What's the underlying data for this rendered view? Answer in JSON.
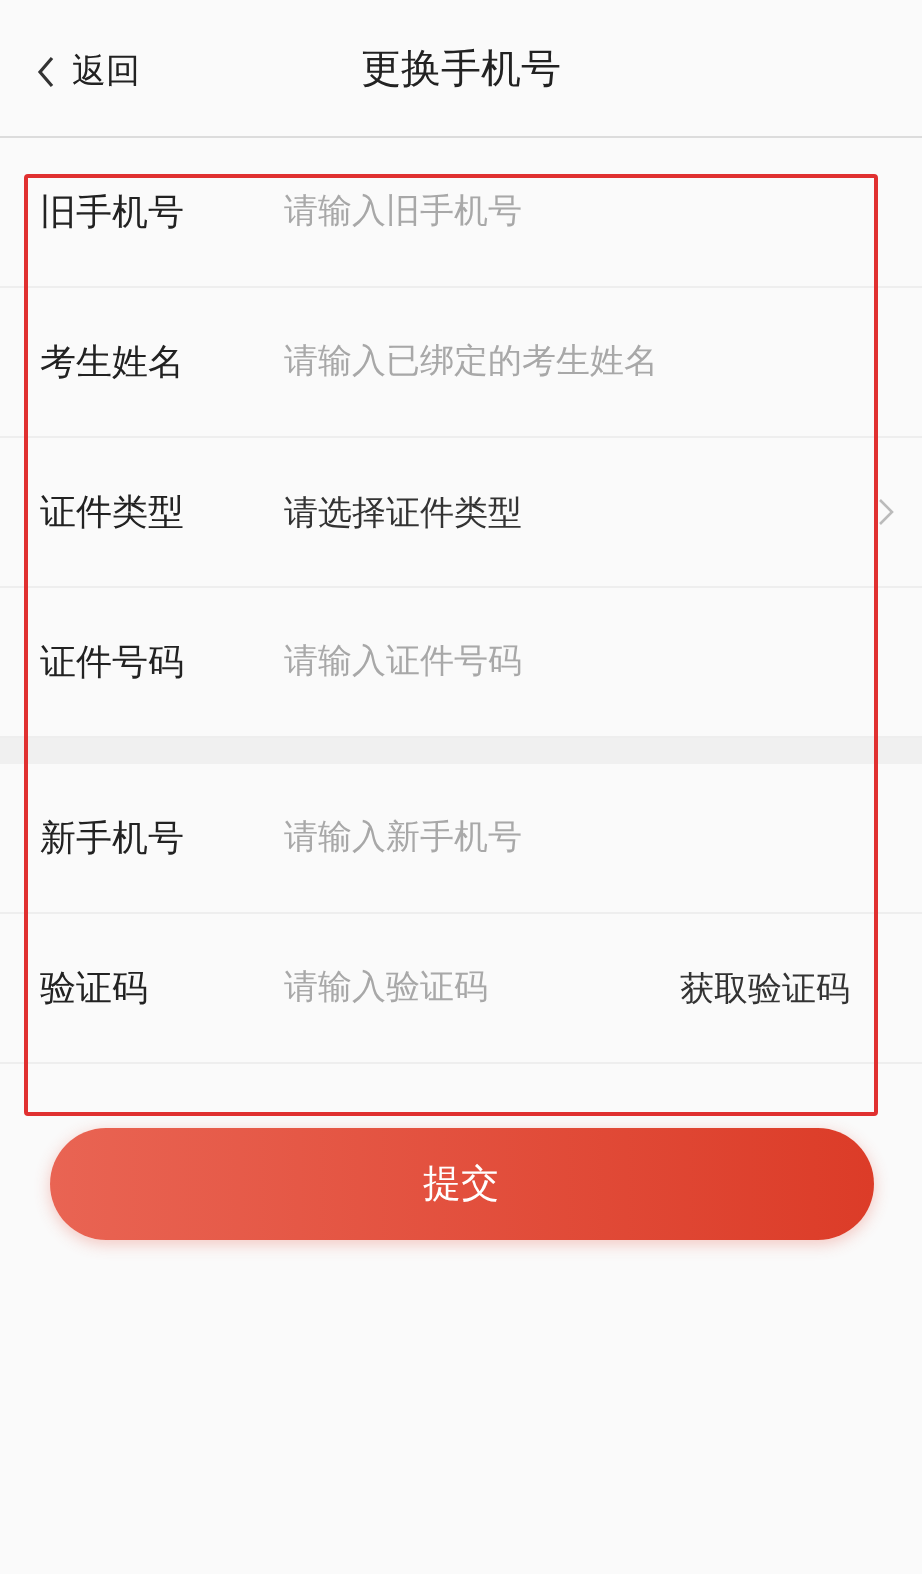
{
  "header": {
    "back": "返回",
    "title": "更换手机号"
  },
  "sections": [
    {
      "rows": [
        {
          "kind": "input",
          "label": "旧手机号",
          "placeholder": "请输入旧手机号"
        },
        {
          "kind": "input",
          "label": "考生姓名",
          "placeholder": "请输入已绑定的考生姓名"
        },
        {
          "kind": "select",
          "label": "证件类型",
          "value": "请选择证件类型"
        },
        {
          "kind": "input",
          "label": "证件号码",
          "placeholder": "请输入证件号码"
        }
      ]
    },
    {
      "rows": [
        {
          "kind": "input",
          "label": "新手机号",
          "placeholder": "请输入新手机号"
        },
        {
          "kind": "code",
          "label": "验证码",
          "placeholder": "请输入验证码",
          "action": "获取验证码"
        }
      ]
    }
  ],
  "submit": "提交"
}
